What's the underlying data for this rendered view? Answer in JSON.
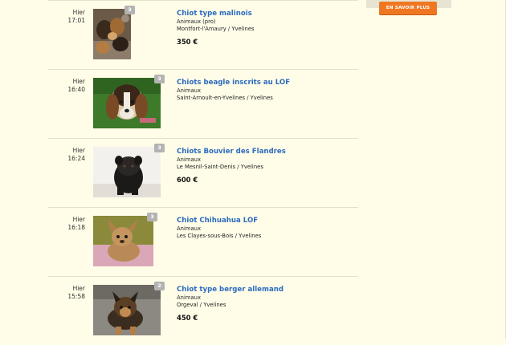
{
  "sidebar": {
    "cta_label": "EN SAVOIR PLUS"
  },
  "listings": [
    {
      "day": "Hier",
      "time": "17:01",
      "photo_count": "3",
      "title": "Chiot type malinois",
      "category": "Animaux (pro)",
      "location": "Montfort-l'Amaury / Yvelines",
      "price": "350 €"
    },
    {
      "day": "Hier",
      "time": "16:40",
      "photo_count": "3",
      "title": "Chiots beagle inscrits au LOF",
      "category": "Animaux",
      "location": "Saint-Arnoult-en-Yvelines / Yvelines",
      "price": ""
    },
    {
      "day": "Hier",
      "time": "16:24",
      "photo_count": "3",
      "title": "Chiots Bouvier des Flandres",
      "category": "Animaux",
      "location": "Le Mesnil-Saint-Denis / Yvelines",
      "price": "600 €"
    },
    {
      "day": "Hier",
      "time": "16:18",
      "photo_count": "3",
      "title": "Chiot Chihuahua LOF",
      "category": "Animaux",
      "location": "Les Clayes-sous-Bois / Yvelines",
      "price": ""
    },
    {
      "day": "Hier",
      "time": "15:58",
      "photo_count": "2",
      "title": "Chiot type berger allemand",
      "category": "Animaux",
      "location": "Orgeval / Yvelines",
      "price": "450 €"
    }
  ]
}
